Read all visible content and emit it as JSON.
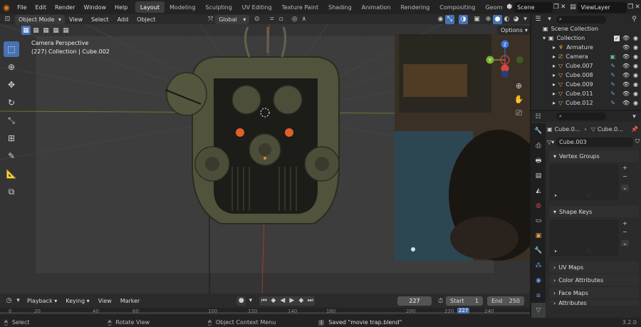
{
  "menubar": {
    "menus": [
      "File",
      "Edit",
      "Render",
      "Window",
      "Help"
    ],
    "workspaces": [
      "Layout",
      "Modeling",
      "Sculpting",
      "UV Editing",
      "Texture Paint",
      "Shading",
      "Animation",
      "Rendering",
      "Compositing",
      "Geometry Noc"
    ],
    "active_workspace": "Layout",
    "scene_value": "Scene",
    "viewlayer_value": "ViewLayer"
  },
  "viewport_header": {
    "mode": "Object Mode",
    "menus": [
      "View",
      "Select",
      "Add",
      "Object"
    ],
    "transform_orientation": "Global",
    "options_label": "Options"
  },
  "viewport": {
    "camera_label": "Camera Perspective",
    "collection_label": "(227) Collection | Cube.002"
  },
  "outliner": {
    "search_placeholder": "",
    "root": "Scene Collection",
    "collection": "Collection",
    "items": [
      "Armature",
      "Camera",
      "Cube.007",
      "Cube.008",
      "Cube.009",
      "Cube.011",
      "Cube.012"
    ]
  },
  "properties": {
    "search_placeholder": "",
    "breadcrumb_object": "Cube.0...",
    "breadcrumb_data": "Cube.0...",
    "mesh_name": "Cube.003",
    "panels": {
      "vertex_groups": "Vertex Groups",
      "shape_keys": "Shape Keys",
      "uv_maps": "UV Maps",
      "color_attributes": "Color Attributes",
      "face_maps": "Face Maps",
      "attributes": "Attributes"
    }
  },
  "timeline": {
    "menus": [
      "Playback",
      "Keying",
      "View",
      "Marker"
    ],
    "current_frame": "227",
    "start_label": "Start",
    "start_value": "1",
    "end_label": "End",
    "end_value": "250",
    "ruler_ticks": [
      "0",
      "20",
      "40",
      "60",
      "100",
      "120",
      "140",
      "160",
      "200",
      "220",
      "227",
      "240"
    ]
  },
  "statusbar": {
    "select": "Select",
    "rotate_view": "Rotate View",
    "context_menu": "Object Context Menu",
    "message": "Saved \"movie trap.blend\"",
    "version": "3.2.0"
  },
  "colors": {
    "accent": "#4772b3",
    "brand": "#e87d0d",
    "frame_highlight": "#4772b3",
    "eye": "#e0602a"
  }
}
